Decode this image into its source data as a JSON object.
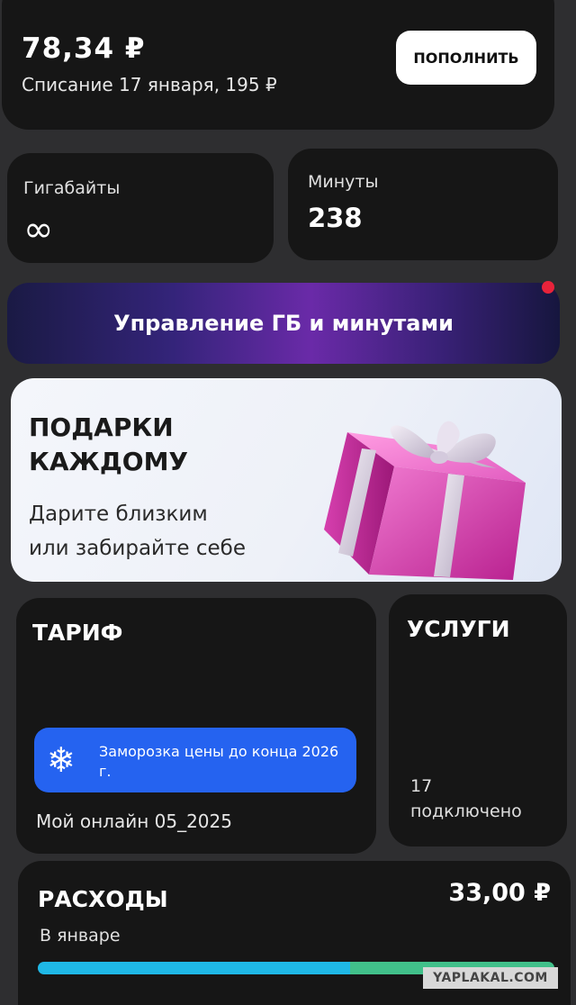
{
  "balance": {
    "amount": "78,34 ₽",
    "charge_text": "Списание 17 января, 195 ₽",
    "topup_label": "ПОПОЛНИТЬ"
  },
  "gigabytes": {
    "label": "Гигабайты",
    "value": "∞"
  },
  "minutes": {
    "label": "Минуты",
    "value": "238"
  },
  "manage": {
    "label": "Управление ГБ и минутами"
  },
  "gifts": {
    "title": "ПОДАРКИ\nКАЖДОМУ",
    "subtitle": "Дарите близким\nили забирайте себе"
  },
  "tariff": {
    "title": "ТАРИФ",
    "freeze_text": "Заморозка цены до конца 2026 г.",
    "name": "Мой онлайн 05_2025"
  },
  "services": {
    "title": "УСЛУГИ",
    "count": "17",
    "count_label": "подключено"
  },
  "expenses": {
    "title": "РАСХОДЫ",
    "amount": "33,00 ₽",
    "period": "В январе",
    "bar_segments": [
      {
        "fraction": 0.605,
        "color": "#1fb8e6"
      },
      {
        "fraction": 0.395,
        "color": "#41c08a"
      }
    ]
  },
  "watermark": "YAPLAKAL.COM",
  "colors": {
    "accent_blue": "#2563f0",
    "notification_red": "#e8233a",
    "card_bg": "#161616"
  },
  "icons": {
    "freeze": "snowflake-icon",
    "gift": "gift-box-icon"
  }
}
